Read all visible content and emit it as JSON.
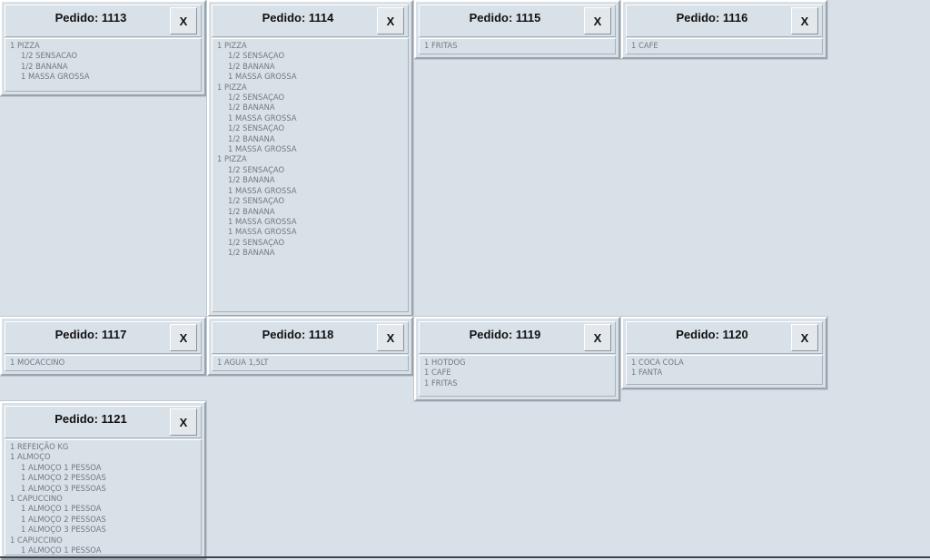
{
  "close_label": "X",
  "orders": [
    {
      "title": "Pedido: 1113",
      "items": [
        {
          "text": "1 PIZZA",
          "sub": false
        },
        {
          "text": "1/2 SENSACAO",
          "sub": true
        },
        {
          "text": "1/2 BANANA",
          "sub": true
        },
        {
          "text": "1 MASSA GROSSA",
          "sub": true
        }
      ]
    },
    {
      "title": "Pedido: 1114",
      "items": [
        {
          "text": "1 PIZZA",
          "sub": false
        },
        {
          "text": "1/2 SENSAÇAO",
          "sub": true
        },
        {
          "text": "1/2 BANANA",
          "sub": true
        },
        {
          "text": "1 MASSA GROSSA",
          "sub": true
        },
        {
          "text": "1 PIZZA",
          "sub": false
        },
        {
          "text": "1/2 SENSAÇAO",
          "sub": true
        },
        {
          "text": "1/2 BANANA",
          "sub": true
        },
        {
          "text": "1 MASSA GROSSA",
          "sub": true
        },
        {
          "text": "1/2 SENSAÇAO",
          "sub": true
        },
        {
          "text": "1/2 BANANA",
          "sub": true
        },
        {
          "text": "1 MASSA GROSSA",
          "sub": true
        },
        {
          "text": "1 PIZZA",
          "sub": false
        },
        {
          "text": "1/2 SENSAÇAO",
          "sub": true
        },
        {
          "text": "1/2 BANANA",
          "sub": true
        },
        {
          "text": "1 MASSA GROSSA",
          "sub": true
        },
        {
          "text": "1/2 SENSAÇAO",
          "sub": true
        },
        {
          "text": "1/2 BANANA",
          "sub": true
        },
        {
          "text": "1 MASSA GROSSA",
          "sub": true
        },
        {
          "text": "1 MASSA GROSSA",
          "sub": true
        },
        {
          "text": "1/2 SENSAÇAO",
          "sub": true
        },
        {
          "text": "1/2 BANANA",
          "sub": true
        }
      ]
    },
    {
      "title": "Pedido: 1115",
      "items": [
        {
          "text": "1 FRITAS",
          "sub": false
        }
      ]
    },
    {
      "title": "Pedido: 1116",
      "items": [
        {
          "text": "1 CAFE",
          "sub": false
        }
      ]
    },
    {
      "title": "Pedido: 1117",
      "items": [
        {
          "text": "1 MOCACCINO",
          "sub": false
        }
      ]
    },
    {
      "title": "Pedido: 1118",
      "items": [
        {
          "text": "1 AGUA 1,5LT",
          "sub": false
        }
      ]
    },
    {
      "title": "Pedido: 1119",
      "items": [
        {
          "text": "1 HOTDOG",
          "sub": false
        },
        {
          "text": "1 CAFE",
          "sub": false
        },
        {
          "text": "1 FRITAS",
          "sub": false
        }
      ]
    },
    {
      "title": "Pedido: 1120",
      "items": [
        {
          "text": "1 COCA COLA",
          "sub": false
        },
        {
          "text": "1 FANTA",
          "sub": false
        }
      ]
    },
    {
      "title": "Pedido: 1121",
      "items": [
        {
          "text": "1 REFEIÇÃO KG",
          "sub": false
        },
        {
          "text": "1 ALMOÇO",
          "sub": false
        },
        {
          "text": "1 ALMOÇO 1 PESSOA",
          "sub": true
        },
        {
          "text": "1 ALMOÇO 2 PESSOAS",
          "sub": true
        },
        {
          "text": "1 ALMOÇO 3 PESSOAS",
          "sub": true
        },
        {
          "text": "1 CAPUCCINO",
          "sub": false
        },
        {
          "text": "1 ALMOÇO 1 PESSOA",
          "sub": true
        },
        {
          "text": "1 ALMOÇO 2 PESSOAS",
          "sub": true
        },
        {
          "text": "1 ALMOÇO 3 PESSOAS",
          "sub": true
        },
        {
          "text": "1 CAPUCCINO",
          "sub": false
        },
        {
          "text": "1 ALMOÇO 1 PESSOA",
          "sub": true
        }
      ]
    }
  ]
}
